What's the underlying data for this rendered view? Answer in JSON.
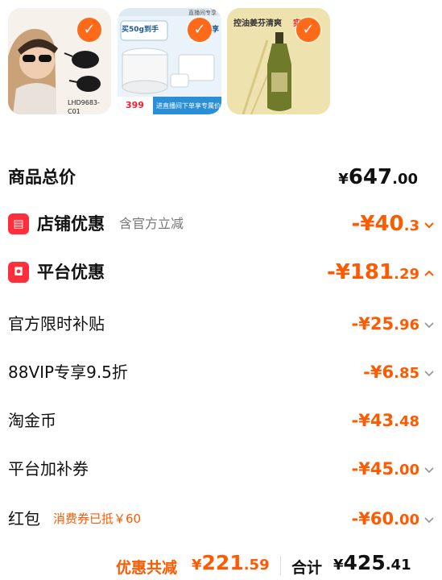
{
  "products": [
    {
      "model_code": "LHD9683-C01",
      "selected": true
    },
    {
      "promo_top": "买50g到手",
      "promo_side": "再享",
      "price": "399",
      "cta": "进直播间下单享专属价",
      "badge": "直播间专享",
      "selected": true
    },
    {
      "headline": "控油姜芬清爽",
      "headline_accent": "实惠",
      "selected": true
    }
  ],
  "summary": {
    "total_label": "商品总价",
    "total_symbol": "¥",
    "total_int": "647",
    "total_dec": ".00",
    "shop_label": "店铺优惠",
    "shop_sub": "含官方立减",
    "shop_prefix": "-¥",
    "shop_int": "40",
    "shop_dec": ".3",
    "platform_label": "平台优惠",
    "platform_prefix": "-¥",
    "platform_int": "181",
    "platform_dec": ".29"
  },
  "platform_items": [
    {
      "label": "官方限时补贴",
      "prefix": "-¥",
      "int": "25",
      "dec": ".96"
    },
    {
      "label": "88VIP专享9.5折",
      "prefix": "-¥",
      "int": "6",
      "dec": ".85"
    },
    {
      "label": "淘金币",
      "prefix": "-¥",
      "int": "43",
      "dec": ".48"
    },
    {
      "label": "平台加补券",
      "prefix": "-¥",
      "int": "45",
      "dec": ".00"
    },
    {
      "label": "红包",
      "note": "消费券已抵￥60",
      "prefix": "-¥",
      "int": "60",
      "dec": ".00"
    }
  ],
  "footer": {
    "discount_label": "优惠共减",
    "discount_symbol": "¥",
    "discount_int": "221",
    "discount_dec": ".59",
    "total_label": "合计",
    "total_symbol": "¥",
    "total_int": "425",
    "total_dec": ".41"
  },
  "colors": {
    "accent": "#ff5a00",
    "badge_red": "#ff2e3a",
    "check_orange": "#ff6a1a"
  }
}
